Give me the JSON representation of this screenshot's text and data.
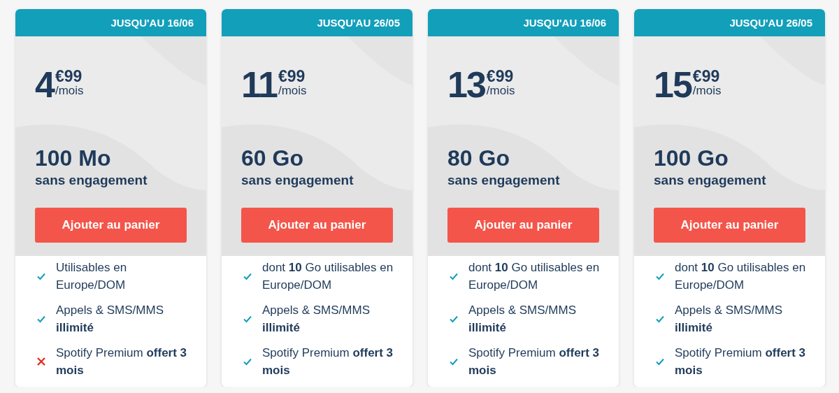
{
  "offers": [
    {
      "badge": "JUSQU'AU 16/06",
      "price_main": "4",
      "price_cents": "€99",
      "price_period": "/mois",
      "data": "100 Mo",
      "commitment": "sans engagement",
      "button": "Ajouter au panier",
      "features": [
        {
          "text": "Utilisables en Europe/DOM",
          "included": true
        },
        {
          "text": "Appels & SMS/MMS **illimité**",
          "included": true
        },
        {
          "text": "Spotify Premium **offert 3 mois**",
          "included": false
        }
      ]
    },
    {
      "badge": "JUSQU'AU 26/05",
      "price_main": "11",
      "price_cents": "€99",
      "price_period": "/mois",
      "data": "60 Go",
      "commitment": "sans engagement",
      "button": "Ajouter au panier",
      "features": [
        {
          "text": "dont **10** Go utilisables en Europe/DOM",
          "included": true
        },
        {
          "text": "Appels & SMS/MMS **illimité**",
          "included": true
        },
        {
          "text": "Spotify Premium **offert 3 mois**",
          "included": true
        }
      ]
    },
    {
      "badge": "JUSQU'AU 16/06",
      "price_main": "13",
      "price_cents": "€99",
      "price_period": "/mois",
      "data": "80 Go",
      "commitment": "sans engagement",
      "button": "Ajouter au panier",
      "features": [
        {
          "text": "dont **10** Go utilisables en Europe/DOM",
          "included": true
        },
        {
          "text": "Appels & SMS/MMS **illimité**",
          "included": true
        },
        {
          "text": "Spotify Premium **offert 3 mois**",
          "included": true
        }
      ]
    },
    {
      "badge": "JUSQU'AU 26/05",
      "price_main": "15",
      "price_cents": "€99",
      "price_period": "/mois",
      "data": "100 Go",
      "commitment": "sans engagement",
      "button": "Ajouter au panier",
      "features": [
        {
          "text": "dont **10** Go utilisables en Europe/DOM",
          "included": true
        },
        {
          "text": "Appels & SMS/MMS **illimité**",
          "included": true
        },
        {
          "text": "Spotify Premium **offert 3 mois**",
          "included": true
        }
      ]
    }
  ]
}
